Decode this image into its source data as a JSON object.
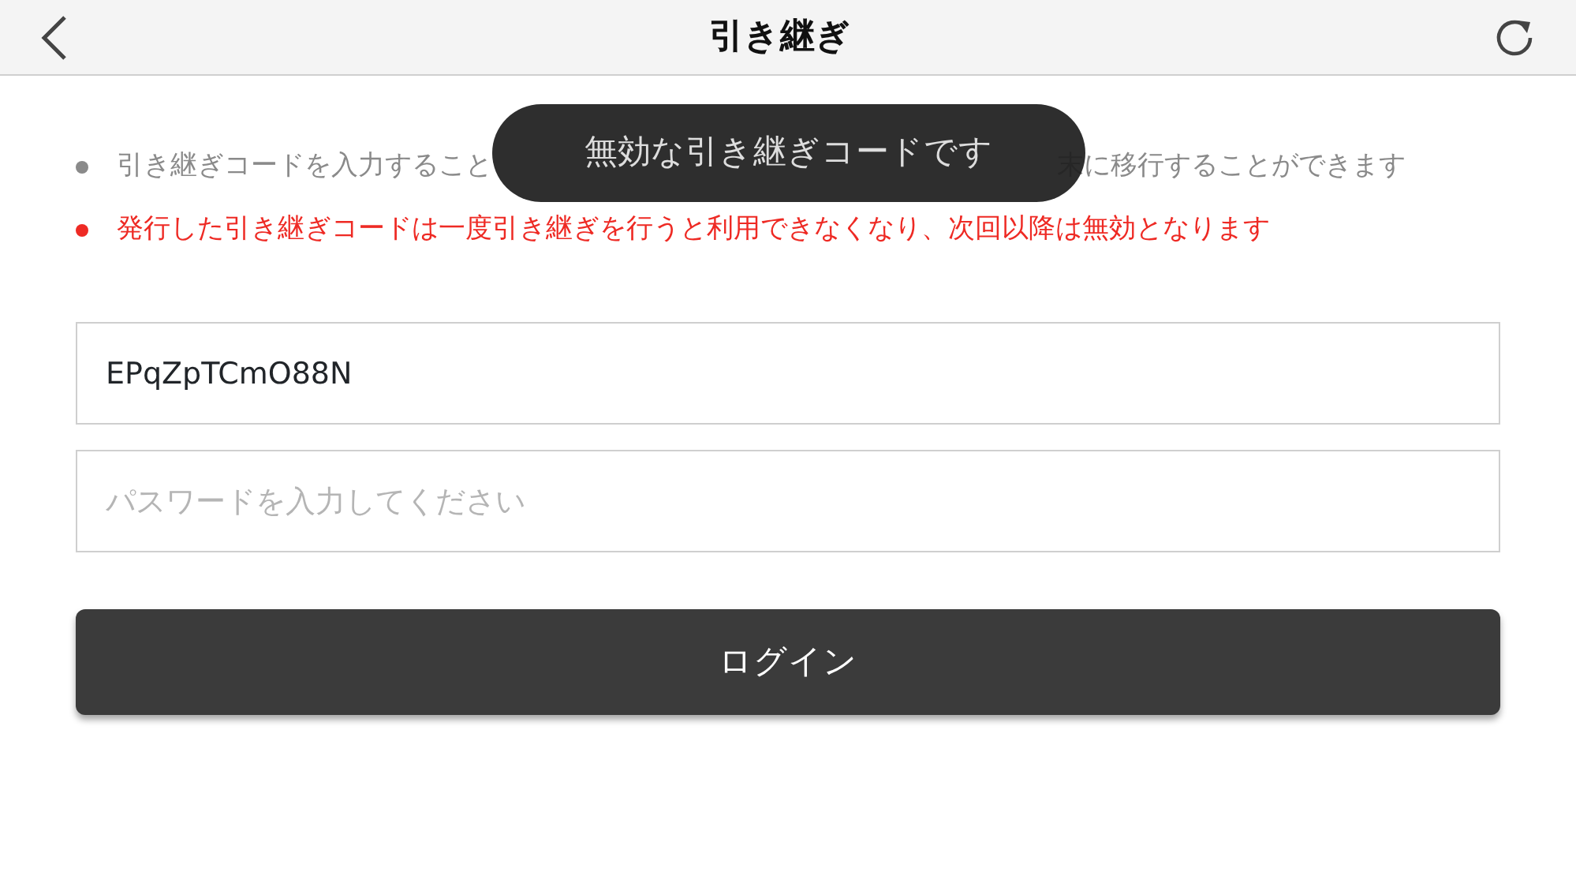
{
  "header": {
    "title": "引き継ぎ"
  },
  "notes": [
    {
      "color": "#8a8a8a",
      "parts": [
        "引き継ぎコードを入力すること",
        "末に移行することができます"
      ]
    },
    {
      "color": "#ee2a24",
      "parts": [
        "発行した引き継ぎコードは一度引き継ぎを行うと利用できなくなり、次回以降は無効となります"
      ]
    }
  ],
  "toast": {
    "text": "無効な引き継ぎコードです"
  },
  "form": {
    "code": {
      "value": "EPqZpTCmO88N"
    },
    "password": {
      "placeholder": "パスワードを入力してください"
    },
    "submit": "ログイン"
  }
}
